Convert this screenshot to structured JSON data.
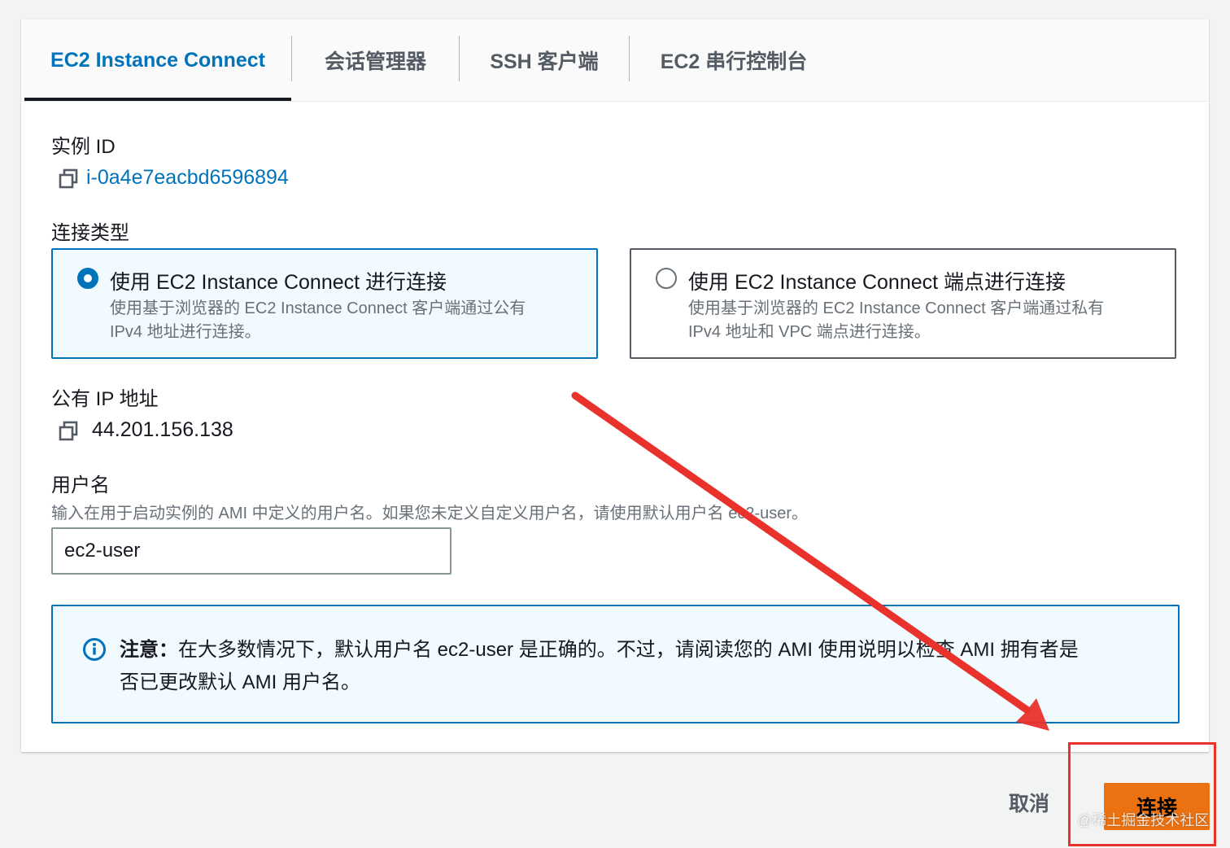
{
  "tabs": [
    {
      "label": "EC2 Instance Connect",
      "active": true
    },
    {
      "label": "会话管理器",
      "active": false
    },
    {
      "label": "SSH 客户端",
      "active": false
    },
    {
      "label": "EC2 串行控制台",
      "active": false
    }
  ],
  "instance": {
    "label": "实例 ID",
    "id": "i-0a4e7eacbd6596894"
  },
  "connection_type": {
    "label": "连接类型",
    "options": [
      {
        "title": "使用 EC2 Instance Connect 进行连接",
        "desc_line1": "使用基于浏览器的 EC2 Instance Connect 客户端通过公有",
        "desc_line2": "IPv4 地址进行连接。",
        "selected": true
      },
      {
        "title": "使用 EC2 Instance Connect 端点进行连接",
        "desc_line1": "使用基于浏览器的 EC2 Instance Connect 客户端通过私有",
        "desc_line2": "IPv4 地址和 VPC 端点进行连接。",
        "selected": false
      }
    ]
  },
  "public_ip": {
    "label": "公有 IP 地址",
    "value": "44.201.156.138"
  },
  "username": {
    "label": "用户名",
    "hint": "输入在用于启动实例的 AMI 中定义的用户名。如果您未定义自定义用户名，请使用默认用户名 ec2-user。",
    "value": "ec2-user"
  },
  "alert": {
    "prefix": "注意：",
    "line1": "在大多数情况下，默认用户名 ec2-user 是正确的。不过，请阅读您的 AMI 使用说明以检查 AMI 拥有者是",
    "line2": "否已更改默认 AMI 用户名。"
  },
  "footer": {
    "cancel_label": "取消",
    "connect_label": "连接"
  },
  "watermark": "@稀土掘金技术社区",
  "colors": {
    "link": "#0073bb",
    "primary_button": "#ec7211",
    "annotation_red": "#e8322b"
  },
  "icons": {
    "copy": "copy-icon",
    "info": "info-icon",
    "annotation_arrow": "red-arrow"
  }
}
